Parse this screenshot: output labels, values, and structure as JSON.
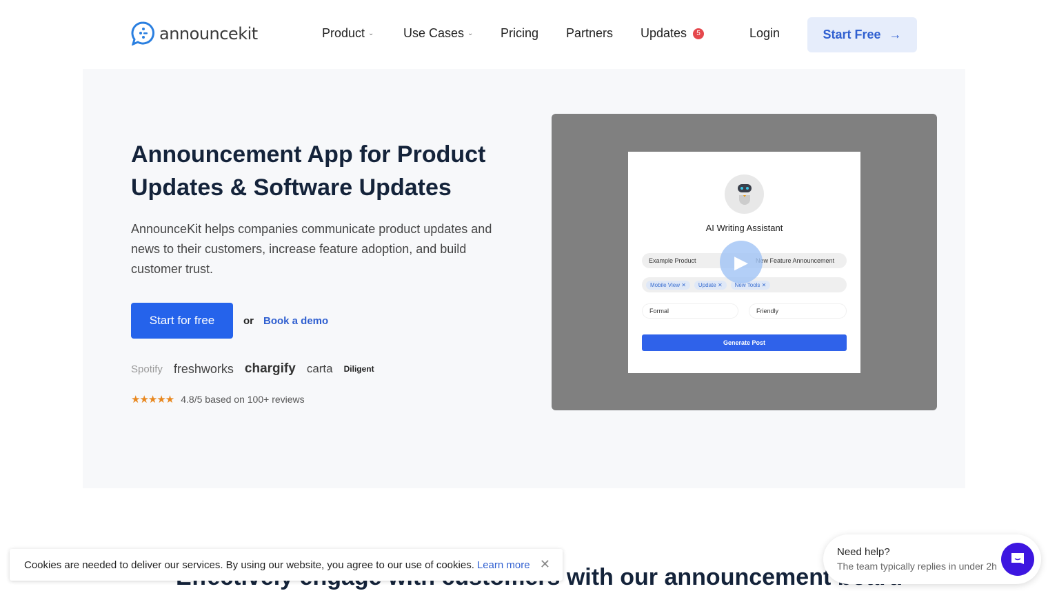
{
  "nav": {
    "logo": "announcekit",
    "items": [
      {
        "label": "Product"
      },
      {
        "label": "Use Cases"
      },
      {
        "label": "Pricing"
      },
      {
        "label": "Partners"
      },
      {
        "label": "Updates",
        "badge": "5"
      }
    ],
    "login": "Login",
    "start_free": "Start Free"
  },
  "hero": {
    "title": "Announcement App for Product Updates & Software Updates",
    "description": "AnnounceKit helps companies communicate product updates and news to their customers, increase feature adoption, and build customer trust.",
    "cta": "Start for free",
    "or": "or",
    "demo": "Book a demo",
    "logos": [
      "Spotify",
      "freshworks",
      "chargify",
      "carta",
      "Diligent"
    ],
    "rating": "4.8/5 based on 100+ reviews",
    "stars": 5
  },
  "video": {
    "title": "AI Writing Assistant",
    "field1": "Example Product",
    "field2": "New Feature Announcement",
    "tags": [
      "Mobile View",
      "Update",
      "New Tools"
    ],
    "tone1": "Formal",
    "tone2": "Friendly",
    "button": "Generate Post"
  },
  "section": {
    "heading": "Effectively engage with customers with our announcement board"
  },
  "cookie": {
    "text": "Cookies are needed to deliver our services. By using our website, you agree to our use of cookies.",
    "link": "Learn more"
  },
  "help": {
    "title": "Need help?",
    "subtitle": "The team typically replies in under 2h"
  },
  "colors": {
    "accent": "#2563eb",
    "badge": "#e5484d",
    "stars": "#e8871e",
    "chat": "#3d16e0"
  }
}
